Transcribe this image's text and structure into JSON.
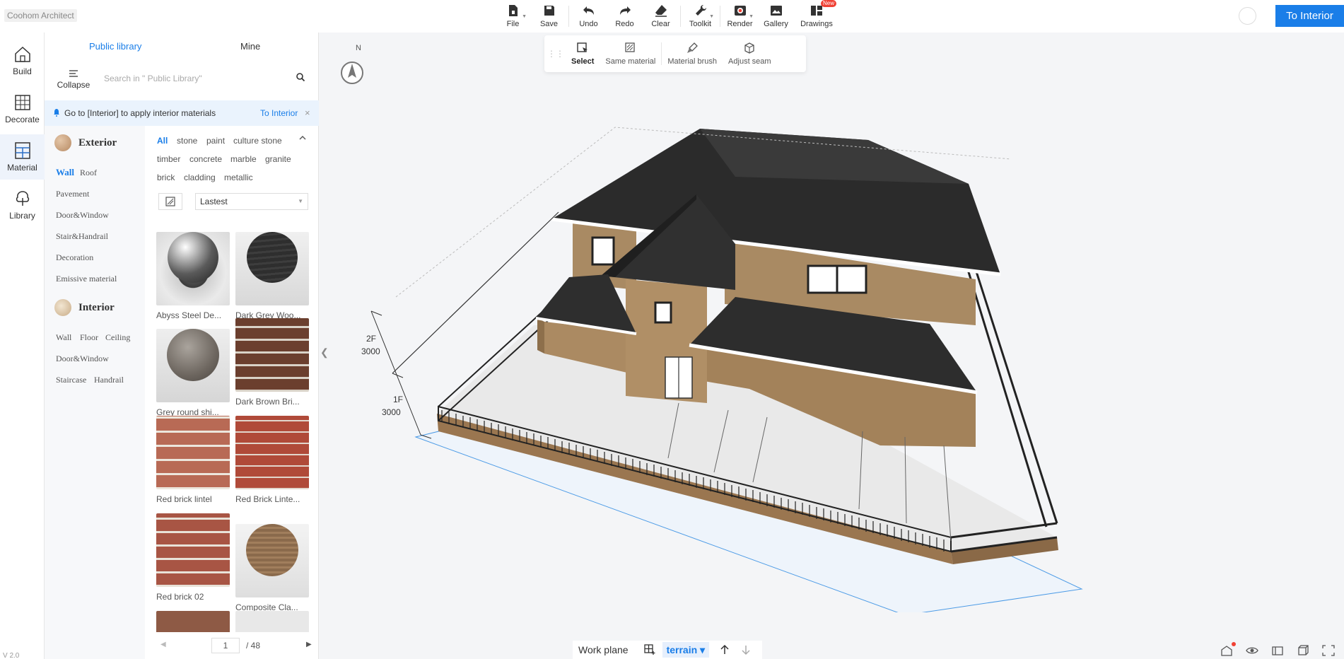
{
  "app": {
    "title": "Coohom Architect",
    "version": "V 2.0"
  },
  "toolbar": {
    "items": [
      {
        "label": "File",
        "icon": "file-icon",
        "caret": true
      },
      {
        "label": "Save",
        "icon": "save-icon"
      },
      {
        "label": "Undo",
        "icon": "undo-icon"
      },
      {
        "label": "Redo",
        "icon": "redo-icon"
      },
      {
        "label": "Clear",
        "icon": "eraser-icon"
      },
      {
        "label": "Toolkit",
        "icon": "wrench-icon",
        "caret": true
      },
      {
        "label": "Render",
        "icon": "camera-icon",
        "caret": true
      },
      {
        "label": "Gallery",
        "icon": "gallery-icon"
      },
      {
        "label": "Drawings",
        "icon": "drawings-icon",
        "badge": "New"
      }
    ],
    "to_interior": "To Interior"
  },
  "rail": {
    "items": [
      {
        "label": "Build",
        "icon": "house-icon"
      },
      {
        "label": "Decorate",
        "icon": "facade-icon"
      },
      {
        "label": "Material",
        "icon": "material-icon",
        "active": true
      },
      {
        "label": "Library",
        "icon": "tree-icon"
      }
    ]
  },
  "library": {
    "tabs": {
      "public": "Public library",
      "mine": "Mine"
    },
    "collapse_label": "Collapse",
    "search_placeholder": "Search in \" Public Library\"",
    "notice": {
      "text": "Go to [Interior] to apply interior materials",
      "link": "To Interior",
      "close": "×"
    },
    "exterior": {
      "title": "Exterior",
      "items": [
        "Wall",
        "Roof",
        "Pavement",
        "Door&Window",
        "Stair&Handrail",
        "Decoration",
        "Emissive material"
      ]
    },
    "interior": {
      "title": "Interior",
      "items": [
        "Wall",
        "Floor",
        "Ceiling",
        "Door&Window",
        "Staircase",
        "Handrail"
      ]
    },
    "filter_tags": [
      "All",
      "stone",
      "paint",
      "culture stone",
      "timber",
      "concrete",
      "marble",
      "granite",
      "brick",
      "cladding",
      "metallic"
    ],
    "sort": "Lastest",
    "materials": [
      "Abyss Steel De...",
      "Dark Grey Woo...",
      "Grey round shi...",
      "Dark Brown Bri...",
      "Red brick lintel",
      "Red Brick Linte...",
      "Red brick 02",
      "Composite Cla..."
    ],
    "pager": {
      "current": "1",
      "total": "/ 48"
    }
  },
  "canvas": {
    "compass_label": "N",
    "subtoolbar": [
      "Select",
      "Same material",
      "Material brush",
      "Adjust seam"
    ],
    "dimensions": [
      {
        "floor": "2F",
        "height": "3000"
      },
      {
        "floor": "1F",
        "height": "3000"
      }
    ]
  },
  "bottom": {
    "workplane": "Work plane",
    "terrain": "terrain ▾"
  },
  "colors": {
    "accent": "#1a7ee8",
    "badge": "#f04134",
    "roof": "#2b2b2b",
    "brick": "#a88258"
  }
}
